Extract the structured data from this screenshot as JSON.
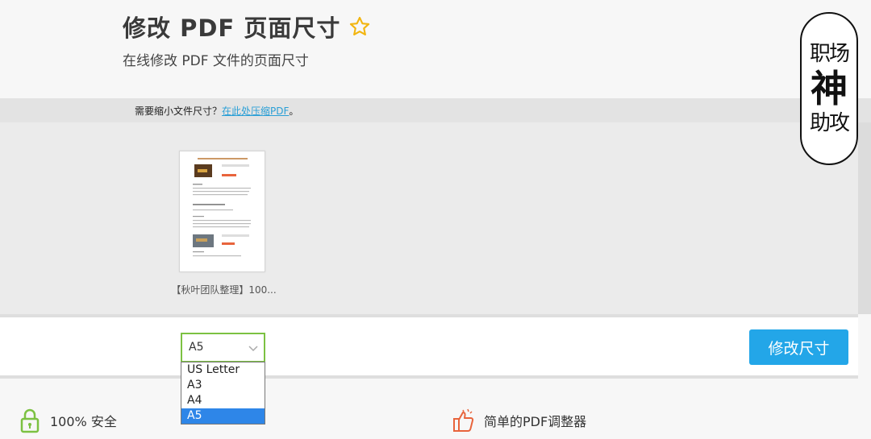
{
  "header": {
    "title": "修改 PDF 页面尺寸",
    "subtitle": "在线修改 PDF 文件的页面尺寸",
    "star_icon": "star-outline-icon"
  },
  "notice": {
    "text": "需要缩小文件尺寸？",
    "link": "在此处压缩PDF",
    "suffix": "。"
  },
  "workspace": {
    "file": {
      "name": "【秋叶团队整理】100..."
    }
  },
  "page_size": {
    "selected": "A5",
    "options": [
      "US Letter",
      "A3",
      "A4",
      "A5"
    ]
  },
  "actions": {
    "resize_label": "修改尺寸"
  },
  "features": {
    "secure_label": "100% 安全",
    "simple_label": "简单的PDF调整器"
  },
  "watermark": {
    "top": "职场",
    "middle": "神",
    "bottom": "助攻"
  },
  "colors": {
    "accent_blue": "#23a6e8",
    "link_blue": "#2a9fd6",
    "select_border": "#7cc142",
    "option_selected": "#2e86e8",
    "icon_green": "#7cc142",
    "icon_orange": "#e8643c"
  }
}
